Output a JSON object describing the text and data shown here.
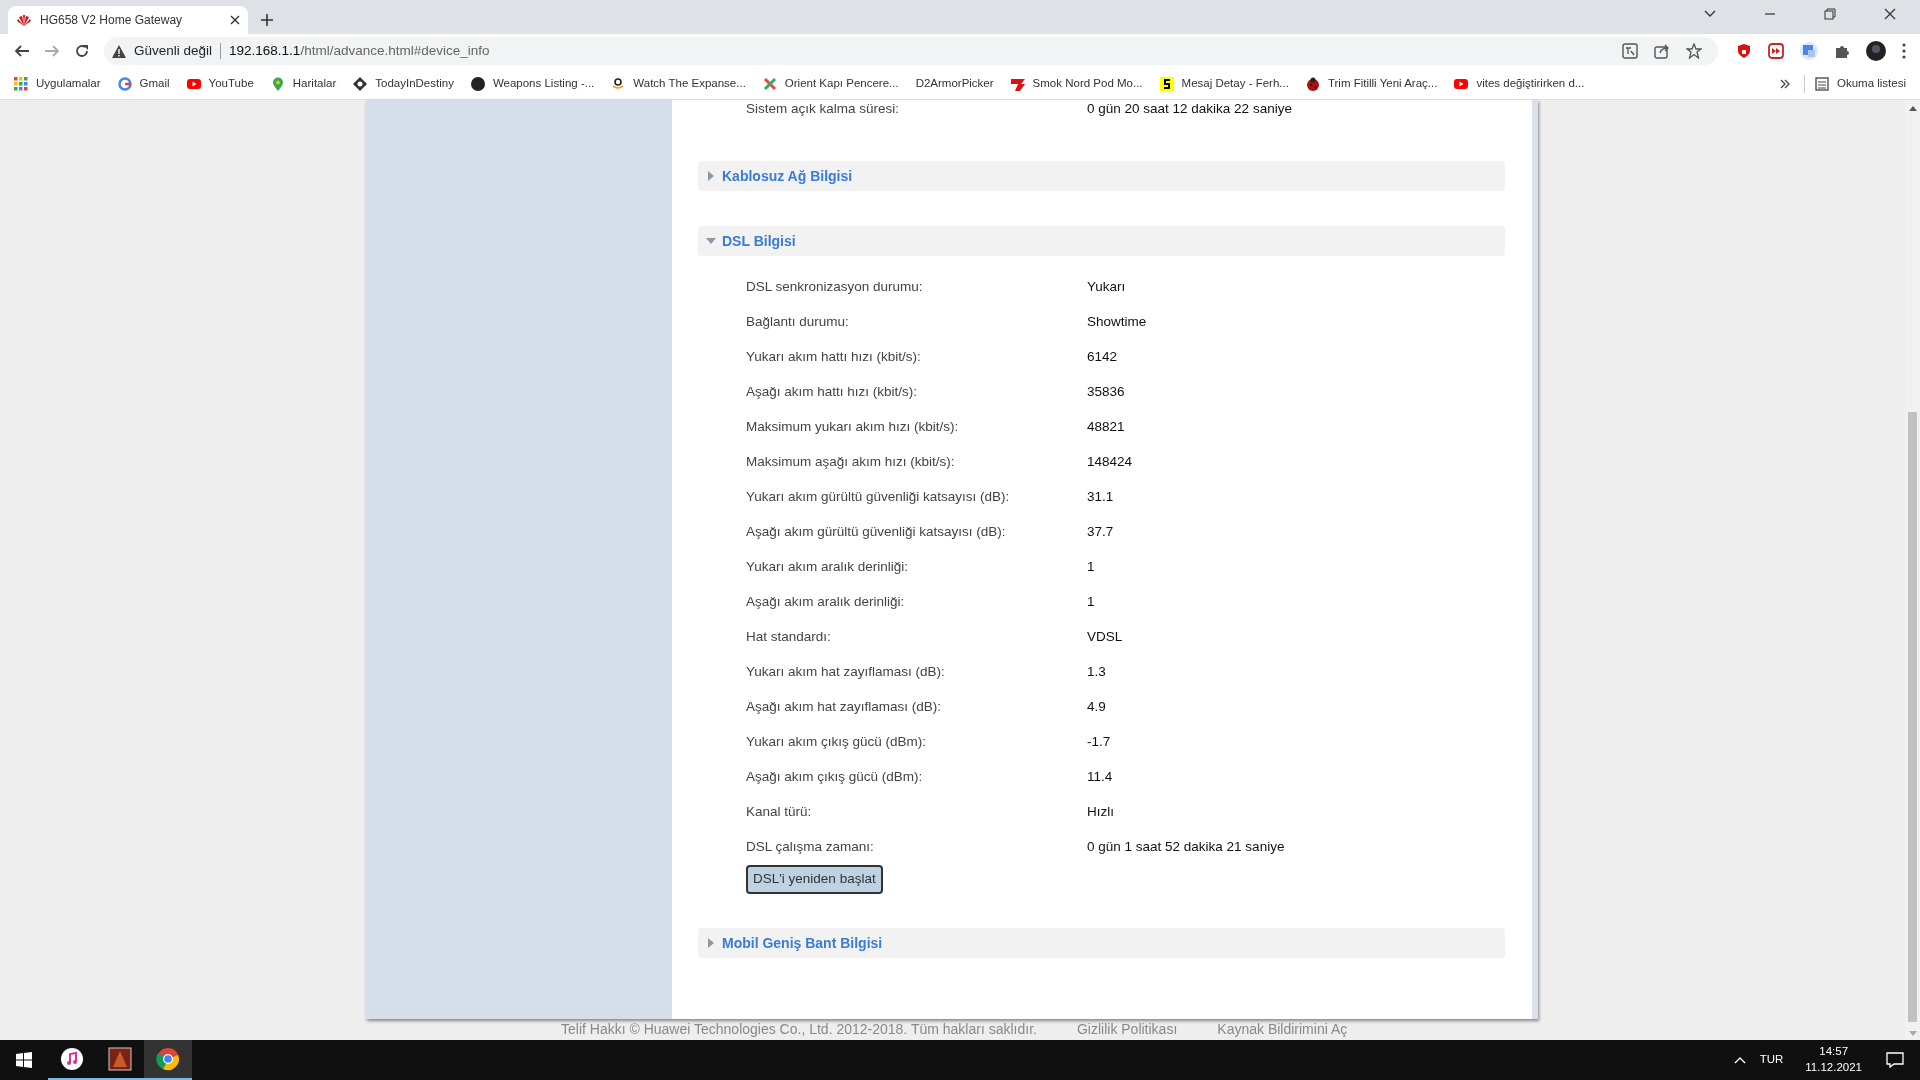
{
  "browser": {
    "tab": {
      "title": "HG658 V2 Home Gateway"
    },
    "address": {
      "security": "Güvenli değil",
      "host": "192.168.1.1",
      "path": "/html/advance.html#device_info"
    },
    "bookmarks": [
      {
        "label": "Uygulamalar"
      },
      {
        "label": "Gmail"
      },
      {
        "label": "YouTube"
      },
      {
        "label": "Haritalar"
      },
      {
        "label": "TodayInDestiny"
      },
      {
        "label": "Weapons Listing -..."
      },
      {
        "label": "Watch The Expanse..."
      },
      {
        "label": "Orient Kapı Pencere..."
      },
      {
        "label": "D2ArmorPicker"
      },
      {
        "label": "Smok Nord Pod Mo..."
      },
      {
        "label": "Mesaj Detay - Ferh..."
      },
      {
        "label": "Trim Fitilli Yeni Araç..."
      },
      {
        "label": "vites değiştirirken d..."
      }
    ],
    "reading_list": "Okuma listesi"
  },
  "page": {
    "top_row": {
      "label": "Sistem açık kalma süresi:",
      "value": "0 gün 20 saat 12 dakika 22 saniye"
    },
    "sections": [
      {
        "title": "Kablosuz Ağ Bilgisi",
        "expanded": false
      },
      {
        "title": "DSL Bilgisi",
        "expanded": true,
        "rows": [
          {
            "label": "DSL senkronizasyon durumu:",
            "value": "Yukarı"
          },
          {
            "label": "Bağlantı durumu:",
            "value": "Showtime"
          },
          {
            "label": "Yukarı akım hattı hızı (kbit/s):",
            "value": "6142"
          },
          {
            "label": "Aşağı akım hattı hızı (kbit/s):",
            "value": "35836"
          },
          {
            "label": "Maksimum yukarı akım hızı (kbit/s):",
            "value": "48821"
          },
          {
            "label": "Maksimum aşağı akım hızı (kbit/s):",
            "value": "148424"
          },
          {
            "label": "Yukarı akım gürültü güvenliği katsayısı (dB):",
            "value": "31.1"
          },
          {
            "label": "Aşağı akım gürültü güvenliği katsayısı (dB):",
            "value": "37.7"
          },
          {
            "label": "Yukarı akım aralık derinliği:",
            "value": "1"
          },
          {
            "label": "Aşağı akım aralık derinliği:",
            "value": "1"
          },
          {
            "label": "Hat standardı:",
            "value": "VDSL"
          },
          {
            "label": "Yukarı akım hat zayıflaması (dB):",
            "value": "1.3"
          },
          {
            "label": "Aşağı akım hat zayıflaması (dB):",
            "value": "4.9"
          },
          {
            "label": "Yukarı akım çıkış gücü (dBm):",
            "value": "-1.7"
          },
          {
            "label": "Aşağı akım çıkış gücü (dBm):",
            "value": "11.4"
          },
          {
            "label": "Kanal türü:",
            "value": "Hızlı"
          },
          {
            "label": "DSL çalışma zamanı:",
            "value": "0 gün 1 saat 52 dakika 21 saniye"
          }
        ],
        "button": "DSL'i yeniden başlat"
      },
      {
        "title": "Mobil Geniş Bant Bilgisi",
        "expanded": false
      }
    ],
    "footer": {
      "copyright": "Telif Hakkı © Huawei Technologies Co., Ltd. 2012-2018. Tüm hakları saklıdır.",
      "links": [
        "Gizlilik Politikası",
        "Kaynak Bildirimini Aç"
      ]
    }
  },
  "taskbar": {
    "language": "TUR",
    "time": "14:57",
    "date": "11.12.2021"
  }
}
